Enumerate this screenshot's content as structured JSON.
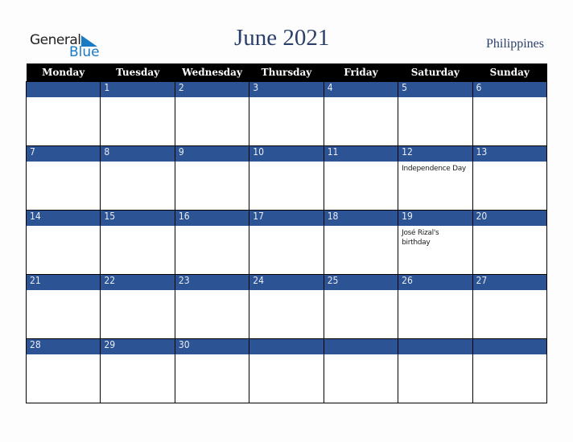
{
  "logo": {
    "line1": "General",
    "line2": "Blue",
    "icon": "triangle-flag-icon",
    "accent": "#1a7ac4"
  },
  "header": {
    "title": "June 2021",
    "country": "Philippines"
  },
  "colors": {
    "header_bg": "#000000",
    "date_band": "#2c5494",
    "title": "#2a3f6a"
  },
  "weekdays": [
    "Monday",
    "Tuesday",
    "Wednesday",
    "Thursday",
    "Friday",
    "Saturday",
    "Sunday"
  ],
  "weeks": [
    {
      "days": [
        "",
        "1",
        "2",
        "3",
        "4",
        "5",
        "6"
      ],
      "events": [
        "",
        "",
        "",
        "",
        "",
        "",
        ""
      ]
    },
    {
      "days": [
        "7",
        "8",
        "9",
        "10",
        "11",
        "12",
        "13"
      ],
      "events": [
        "",
        "",
        "",
        "",
        "",
        "Independence Day",
        ""
      ]
    },
    {
      "days": [
        "14",
        "15",
        "16",
        "17",
        "18",
        "19",
        "20"
      ],
      "events": [
        "",
        "",
        "",
        "",
        "",
        "José Rizal's birthday",
        ""
      ]
    },
    {
      "days": [
        "21",
        "22",
        "23",
        "24",
        "25",
        "26",
        "27"
      ],
      "events": [
        "",
        "",
        "",
        "",
        "",
        "",
        ""
      ]
    },
    {
      "days": [
        "28",
        "29",
        "30",
        "",
        "",
        "",
        ""
      ],
      "events": [
        "",
        "",
        "",
        "",
        "",
        "",
        ""
      ]
    }
  ]
}
